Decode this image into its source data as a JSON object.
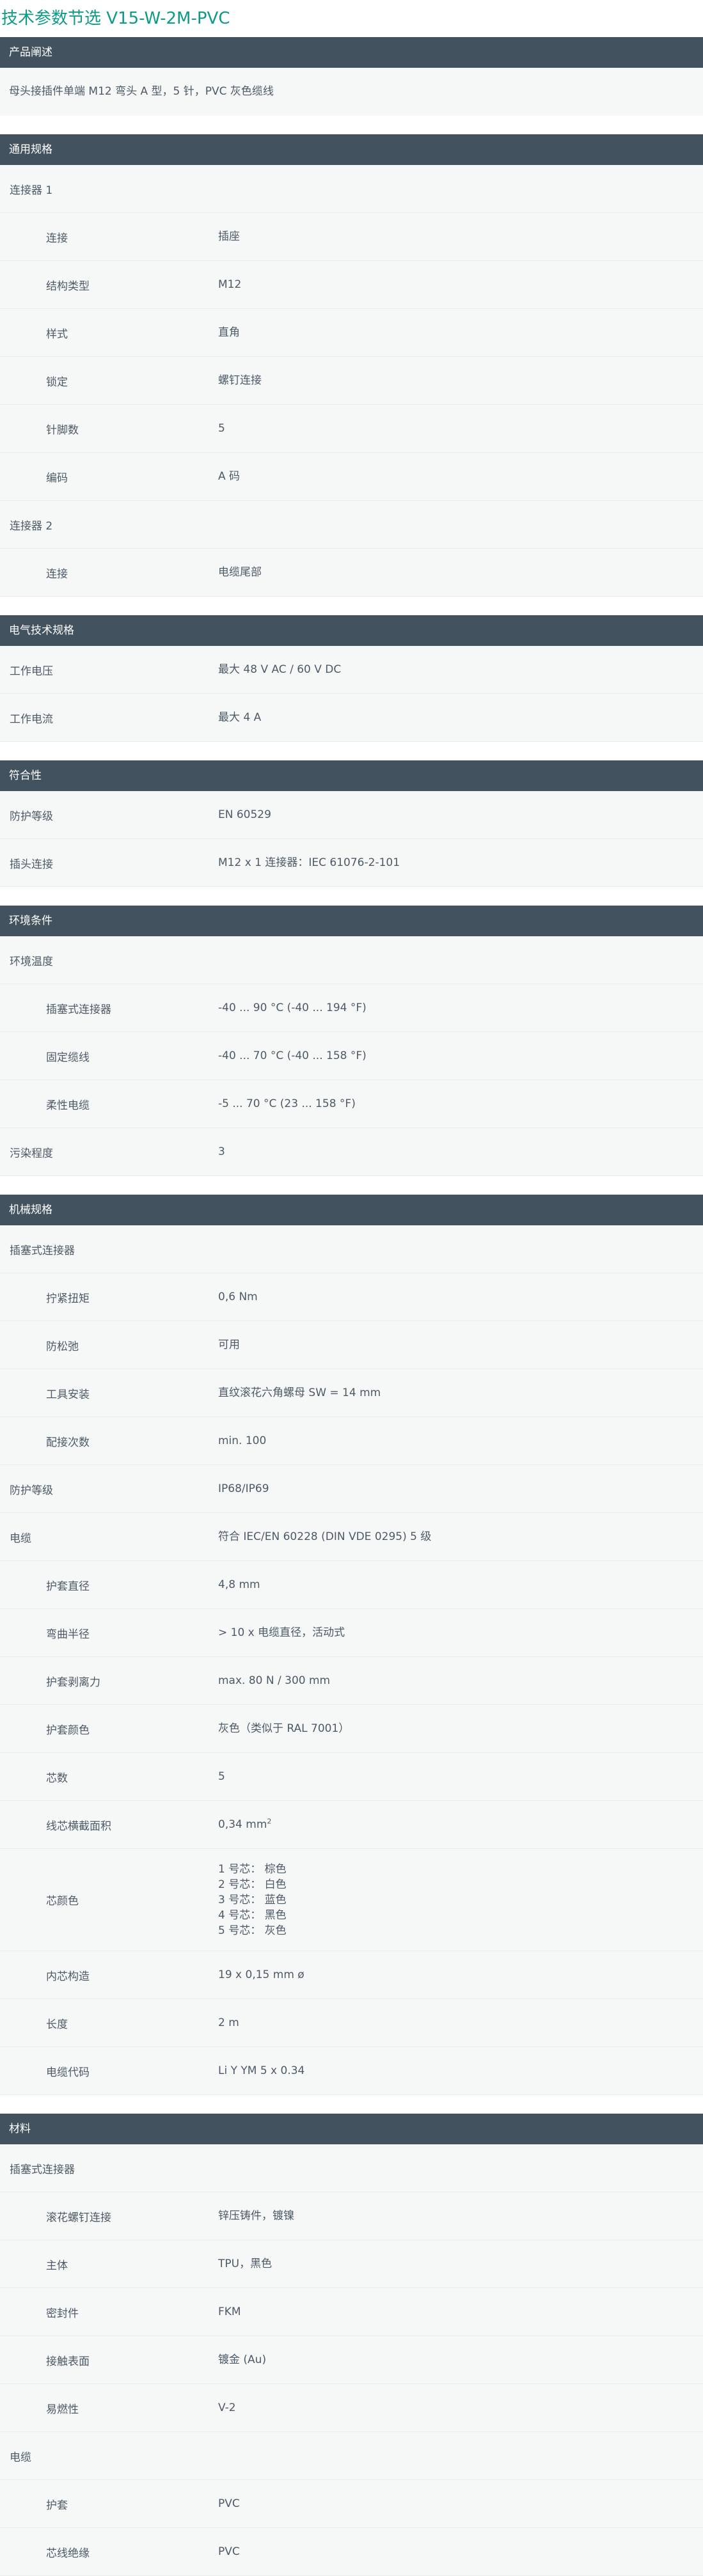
{
  "page": {
    "title": "技术参数节选  V15-W-2M-PVC"
  },
  "sections": [
    {
      "header": "产品阐述",
      "type": "description",
      "text": "母头接插件单端 M12 弯头 A 型，5 针，PVC 灰色缆线"
    },
    {
      "header": "通用规格",
      "rows": [
        {
          "label": "连接器 1",
          "value": "",
          "indent": false
        },
        {
          "label": "连接",
          "value": "插座",
          "indent": true
        },
        {
          "label": "结构类型",
          "value": "M12",
          "indent": true
        },
        {
          "label": "样式",
          "value": "直角",
          "indent": true
        },
        {
          "label": "锁定",
          "value": "螺钉连接",
          "indent": true
        },
        {
          "label": "针脚数",
          "value": "5",
          "indent": true
        },
        {
          "label": "编码",
          "value": "A 码",
          "indent": true
        },
        {
          "label": "连接器 2",
          "value": "",
          "indent": false
        },
        {
          "label": "连接",
          "value": "电缆尾部",
          "indent": true
        }
      ]
    },
    {
      "header": "电气技术规格",
      "rows": [
        {
          "label": "工作电压",
          "value": "最大 48 V AC / 60 V DC",
          "indent": false
        },
        {
          "label": "工作电流",
          "value": "最大 4 A",
          "indent": false
        }
      ]
    },
    {
      "header": "符合性",
      "rows": [
        {
          "label": "防护等级",
          "value": "EN 60529",
          "indent": false
        },
        {
          "label": "插头连接",
          "value": "M12 x 1 连接器：IEC 61076-2-101",
          "indent": false
        }
      ]
    },
    {
      "header": "环境条件",
      "rows": [
        {
          "label": "环境温度",
          "value": "",
          "indent": false
        },
        {
          "label": "插塞式连接器",
          "value": "-40 ... 90 °C (-40 ... 194 °F)",
          "indent": true
        },
        {
          "label": "固定缆线",
          "value": "-40 ... 70 °C (-40 ... 158 °F)",
          "indent": true
        },
        {
          "label": "柔性电缆",
          "value": "-5 ... 70 °C (23 ... 158 °F)",
          "indent": true
        },
        {
          "label": "污染程度",
          "value": "3",
          "indent": false
        }
      ]
    },
    {
      "header": "机械规格",
      "rows": [
        {
          "label": "插塞式连接器",
          "value": "",
          "indent": false
        },
        {
          "label": "拧紧扭矩",
          "value": "0,6 Nm",
          "indent": true
        },
        {
          "label": "防松弛",
          "value": "可用",
          "indent": true
        },
        {
          "label": "工具安装",
          "value": "直纹滚花六角螺母 SW = 14 mm",
          "indent": true
        },
        {
          "label": "配接次数",
          "value": "min. 100",
          "indent": true
        },
        {
          "label": "防护等级",
          "value": "IP68/IP69",
          "indent": false
        },
        {
          "label": "电缆",
          "value": "符合 IEC/EN 60228 (DIN VDE 0295) 5 级",
          "indent": false
        },
        {
          "label": "护套直径",
          "value": "4,8 mm",
          "indent": true
        },
        {
          "label": "弯曲半径",
          "value": "> 10 x 电缆直径，活动式",
          "indent": true
        },
        {
          "label": "护套剥离力",
          "value": "max. 80 N / 300 mm",
          "indent": true
        },
        {
          "label": "护套颜色",
          "value": "灰色（类似于 RAL 7001）",
          "indent": true
        },
        {
          "label": "芯数",
          "value": "5",
          "indent": true
        },
        {
          "label": "线芯横截面积",
          "value": "0,34 mm",
          "value_sup": "2",
          "indent": true
        },
        {
          "label": "芯颜色",
          "lines": [
            "1 号芯： 棕色",
            "2 号芯： 白色",
            "3 号芯： 蓝色",
            "4 号芯： 黑色",
            "5 号芯： 灰色"
          ],
          "indent": true
        },
        {
          "label": "内芯构造",
          "value": "19 x 0,15 mm ø",
          "indent": true
        },
        {
          "label": "长度",
          "value": "2 m",
          "indent": true
        },
        {
          "label": "电缆代码",
          "value": "Li Y YM 5 x 0.34",
          "indent": true
        }
      ]
    },
    {
      "header": "材料",
      "rows": [
        {
          "label": "插塞式连接器",
          "value": "",
          "indent": false
        },
        {
          "label": "滚花螺钉连接",
          "value": "锌压铸件，镀镍",
          "indent": true
        },
        {
          "label": "主体",
          "value": "TPU，黑色",
          "indent": true
        },
        {
          "label": "密封件",
          "value": "FKM",
          "indent": true
        },
        {
          "label": "接触表面",
          "value": "镀金 (Au)",
          "indent": true
        },
        {
          "label": "易燃性",
          "value": "V-2",
          "indent": true
        },
        {
          "label": "电缆",
          "value": "",
          "indent": false
        },
        {
          "label": "护套",
          "value": "PVC",
          "indent": true
        },
        {
          "label": "芯线绝缘",
          "value": "PVC",
          "indent": true
        }
      ]
    }
  ]
}
